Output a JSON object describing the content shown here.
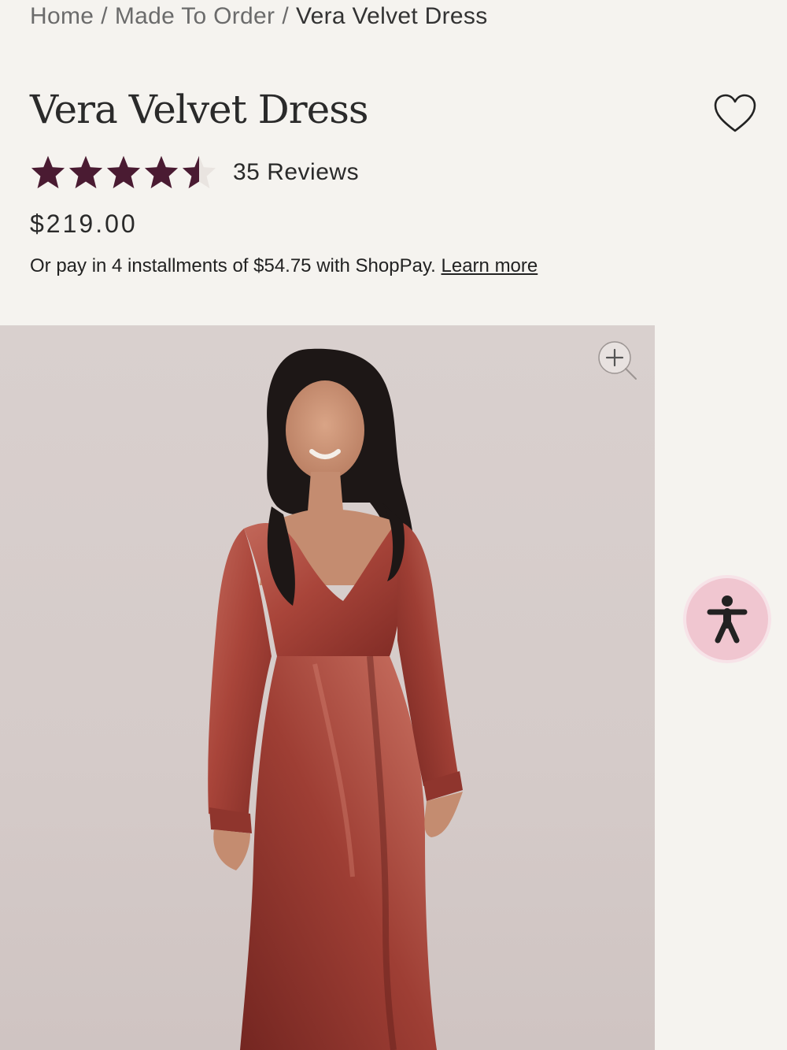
{
  "breadcrumb": {
    "home": "Home",
    "separator": "/",
    "category": "Made To Order",
    "current": "Vera Velvet Dress"
  },
  "product": {
    "title": "Vera Velvet Dress",
    "rating": 4.5,
    "rating_max": 5,
    "reviews_label": "35 Reviews",
    "price": "$219.00",
    "installments_text": "Or pay in 4 installments of $54.75 with ShopPay.",
    "learn_more": "Learn more"
  },
  "icons": {
    "wishlist": "heart-outline-icon",
    "star": "star-icon",
    "zoom": "zoom-in-icon",
    "accessibility": "accessibility-icon"
  },
  "colors": {
    "background": "#f5f3ef",
    "star": "#4a1b32",
    "accessibility_bg": "#f0c6d0",
    "dress": "#a9453a"
  }
}
